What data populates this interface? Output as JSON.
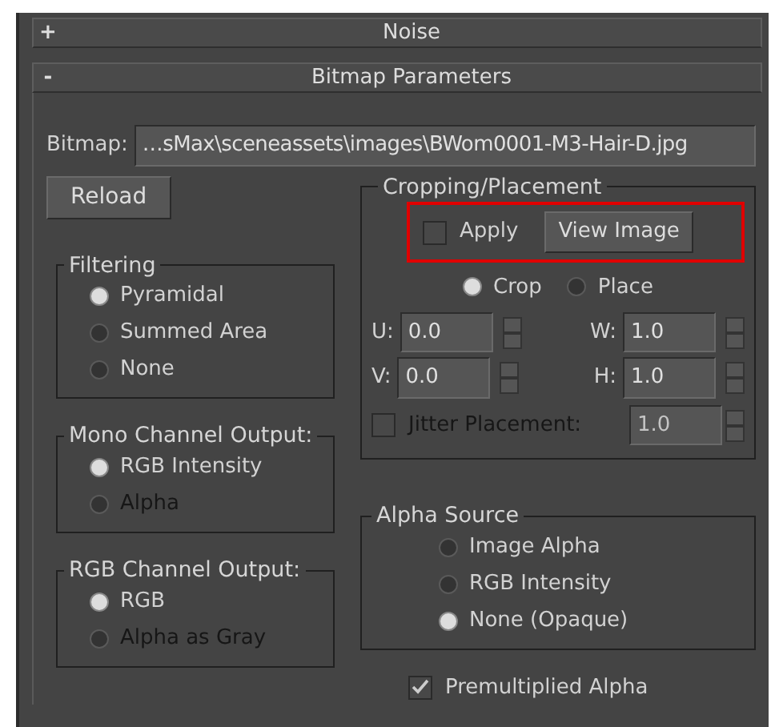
{
  "rollouts": [
    {
      "symbol": "+",
      "title": "Noise"
    },
    {
      "symbol": "-",
      "title": "Bitmap Parameters"
    }
  ],
  "bitmap": {
    "label": "Bitmap:",
    "value": "…sMax\\sceneassets\\images\\BWom0001-M3-Hair-D.jpg"
  },
  "reload_button": "Reload",
  "left_groups": [
    {
      "title": "Filtering",
      "options": [
        {
          "label": "Pyramidal",
          "selected": true,
          "disabled": false
        },
        {
          "label": "Summed Area",
          "selected": false,
          "disabled": false
        },
        {
          "label": "None",
          "selected": false,
          "disabled": false
        }
      ]
    },
    {
      "title": "Mono Channel Output:",
      "options": [
        {
          "label": "RGB Intensity",
          "selected": true,
          "disabled": false
        },
        {
          "label": "Alpha",
          "selected": false,
          "disabled": true
        }
      ]
    },
    {
      "title": "RGB Channel Output:",
      "options": [
        {
          "label": "RGB",
          "selected": true,
          "disabled": false
        },
        {
          "label": "Alpha as Gray",
          "selected": false,
          "disabled": true
        }
      ]
    }
  ],
  "cropping": {
    "title": "Cropping/Placement",
    "highlighted": true,
    "apply": {
      "label": "Apply",
      "checked": false
    },
    "view_button": "View Image",
    "modes": [
      {
        "label": "Crop",
        "selected": true
      },
      {
        "label": "Place",
        "selected": false
      }
    ],
    "fields": [
      {
        "label": "U:",
        "value": "0.0"
      },
      {
        "label": "W:",
        "value": "1.0"
      },
      {
        "label": "V:",
        "value": "0.0"
      },
      {
        "label": "H:",
        "value": "1.0"
      }
    ],
    "jitter": {
      "label": "Jitter Placement:",
      "checked": false,
      "disabled": true,
      "value": "1.0"
    }
  },
  "alpha_source": {
    "title": "Alpha Source",
    "options": [
      {
        "label": "Image Alpha",
        "selected": false,
        "disabled": false
      },
      {
        "label": "RGB Intensity",
        "selected": false,
        "disabled": false
      },
      {
        "label": "None (Opaque)",
        "selected": true,
        "disabled": false
      }
    ]
  },
  "premultiplied": {
    "label": "Premultiplied Alpha",
    "checked": true
  }
}
